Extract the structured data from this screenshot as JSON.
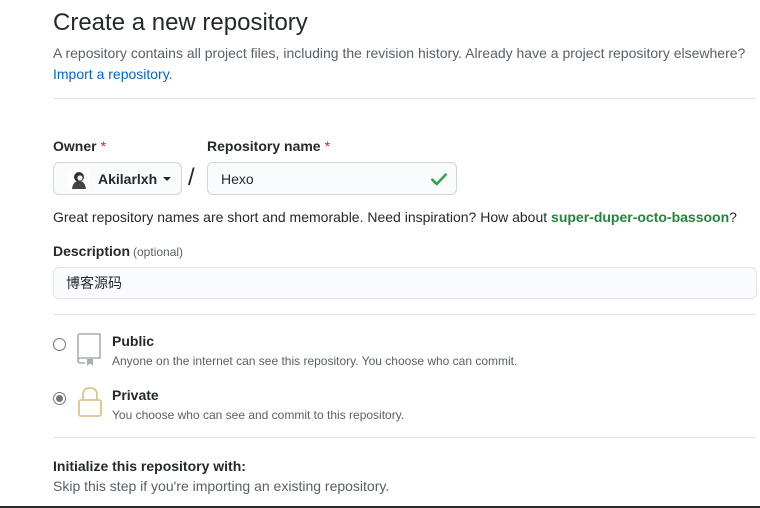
{
  "header": {
    "title": "Create a new repository",
    "subtitle": "A repository contains all project files, including the revision history. Already have a project repository elsewhere?",
    "import_link": "Import a repository."
  },
  "owner": {
    "label": "Owner",
    "required_mark": "*",
    "value": "Akilarlxh"
  },
  "separator": "/",
  "repo_name": {
    "label": "Repository name",
    "required_mark": "*",
    "value": "Hexo",
    "valid": true
  },
  "inspiration": {
    "text": "Great repository names are short and memorable. Need inspiration? How about",
    "suggestion": "super-duper-octo-bassoon",
    "suffix": "?"
  },
  "description": {
    "label": "Description",
    "optional": "(optional)",
    "value": "博客源码"
  },
  "visibility": {
    "selected": "private",
    "public": {
      "title": "Public",
      "desc": "Anyone on the internet can see this repository. You choose who can commit.",
      "icon": "repo-icon"
    },
    "private": {
      "title": "Private",
      "desc": "You choose who can see and commit to this repository.",
      "icon": "lock-icon"
    }
  },
  "initialize": {
    "title": "Initialize this repository with:",
    "desc": "Skip this step if you're importing an existing repository."
  },
  "colors": {
    "link": "#0366d6",
    "required": "#cb2431",
    "success": "#28a745",
    "suggestion": "#22863a"
  }
}
